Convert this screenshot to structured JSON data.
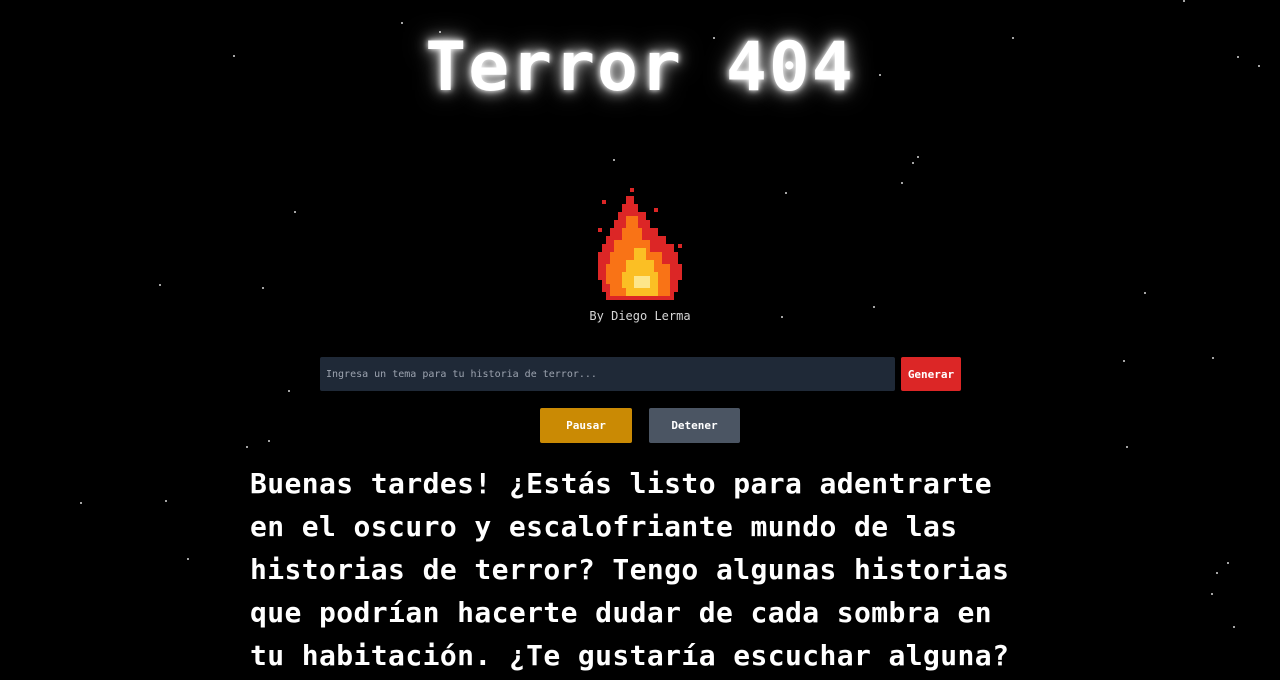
{
  "app": {
    "title": "Terror 404",
    "byline": "By Diego Lerma"
  },
  "icons": {
    "logo": "pixel-flame-icon"
  },
  "colors": {
    "background": "#000000",
    "input_bg": "#1f2937",
    "generate": "#dc2626",
    "pause": "#ca8a04",
    "stop": "#4b5563",
    "text": "#ffffff"
  },
  "search": {
    "placeholder": "Ingresa un tema para tu historia de terror...",
    "value": "",
    "generate_label": "Generar"
  },
  "controls": {
    "pause_label": "Pausar",
    "stop_label": "Detener"
  },
  "story": {
    "text": "Buenas tardes! ¿Estás listo para adentrarte en el oscuro y escalofriante mundo de las historias de terror? Tengo algunas historias que podrían hacerte dudar de cada sombra en tu habitación. ¿Te gustaría escuchar alguna?"
  }
}
